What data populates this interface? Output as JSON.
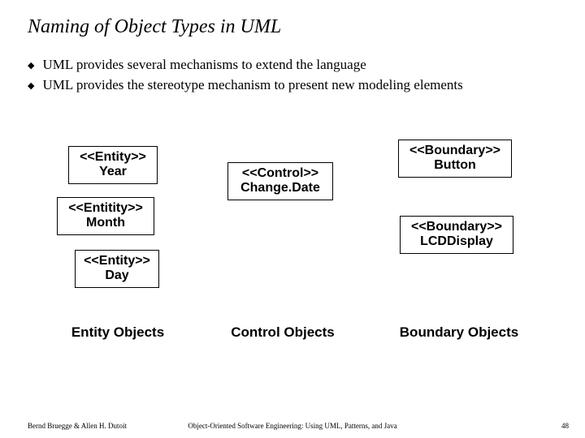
{
  "title": "Naming of Object Types in UML",
  "bullets": [
    "UML provides several mechanisms to extend the language",
    "UML provides the stereotype mechanism to present new modeling elements"
  ],
  "boxes": {
    "entity_year": {
      "stereo": "<<Entity>>",
      "name": "Year"
    },
    "entity_month": {
      "stereo": "<<Entitity>>",
      "name": "Month"
    },
    "entity_day": {
      "stereo": "<<Entity>>",
      "name": "Day"
    },
    "control_changedate": {
      "stereo": "<<Control>>",
      "name": "Change.Date"
    },
    "boundary_button": {
      "stereo": "<<Boundary>>",
      "name": "Button"
    },
    "boundary_lcd": {
      "stereo": "<<Boundary>>",
      "name": "LCDDisplay"
    }
  },
  "columns": {
    "entity": "Entity Objects",
    "control": "Control Objects",
    "boundary": "Boundary Objects"
  },
  "footer": {
    "left": "Bernd Bruegge & Allen H. Dutoit",
    "center": "Object-Oriented Software Engineering: Using UML, Patterns, and Java",
    "right": "48"
  }
}
